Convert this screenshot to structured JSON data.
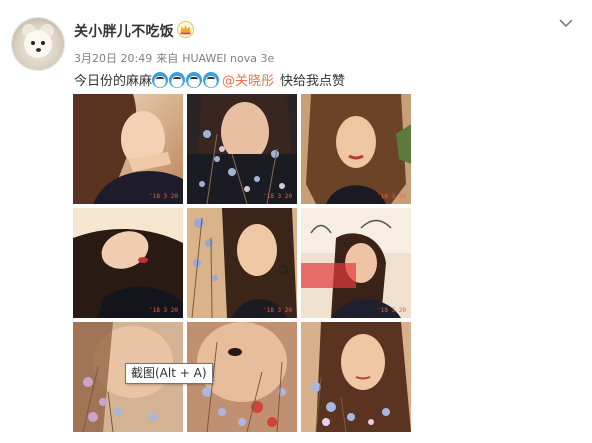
{
  "user": {
    "name": "关小胖儿不吃饭",
    "avatar_icon": "pomeranian-dog-avatar",
    "badge_icon": "crown-badge-icon",
    "badge_color": "#f5a623"
  },
  "meta": {
    "date": "3月20日 20:49",
    "source_prefix": "来自",
    "device": "HUAWEI nova 3e"
  },
  "post": {
    "text_before": "今日份的麻麻",
    "emoji_count": 4,
    "mention": "@关晓彤",
    "text_after": "快给我点赞",
    "mention_color": "#eb7350"
  },
  "photos": [
    {
      "id": 1,
      "subject": "portrait-hand-on-face",
      "watermark_date": "'18 3 20"
    },
    {
      "id": 2,
      "subject": "portrait-dried-flowers",
      "watermark_date": "'18 3 20"
    },
    {
      "id": 3,
      "subject": "portrait-tousled-hair-plant",
      "watermark_date": "'18 3 20"
    },
    {
      "id": 4,
      "subject": "portrait-lying-red-lips",
      "watermark_date": "'18 3 20"
    },
    {
      "id": 5,
      "subject": "portrait-dried-flowers",
      "watermark_date": "'18 3 20"
    },
    {
      "id": 6,
      "subject": "portrait-red-light-window",
      "watermark_date": "'18 3 20"
    },
    {
      "id": 7,
      "subject": "portrait-flower-blur",
      "watermark_date": ""
    },
    {
      "id": 8,
      "subject": "portrait-flower-closeup",
      "watermark_date": ""
    },
    {
      "id": 9,
      "subject": "portrait-flowers-front",
      "watermark_date": ""
    }
  ],
  "tooltip": {
    "text": "截图(Alt + A)"
  },
  "dropdown_icon": "chevron-down-icon"
}
